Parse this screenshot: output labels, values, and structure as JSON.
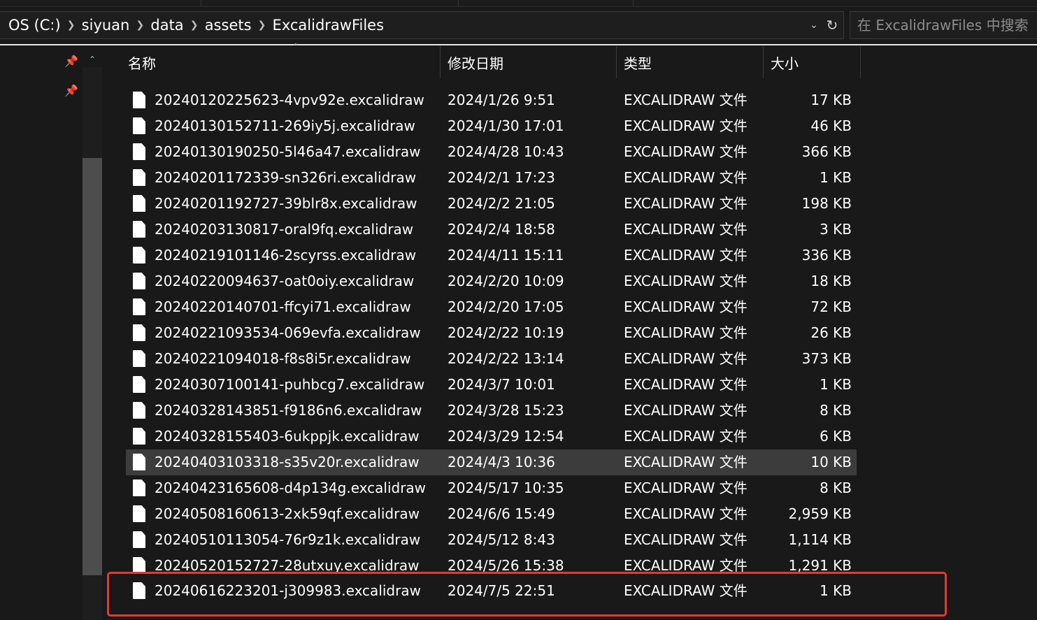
{
  "address_bar": {
    "crumbs": [
      "OS (C:)",
      "siyuan",
      "data",
      "assets",
      "ExcalidrawFiles"
    ],
    "separator_icon": "chevron-right-icon",
    "dropdown_icon": "chevron-down-icon",
    "refresh_icon": "refresh-icon"
  },
  "search": {
    "placeholder": "在 ExcalidrawFiles 中搜索"
  },
  "nav": {
    "pin_icon": "pin-icon",
    "scroll_up_icon": "chevron-up-icon"
  },
  "columns": {
    "name": "名称",
    "date": "修改日期",
    "type": "类型",
    "size": "大小"
  },
  "files": [
    {
      "name": "20240120225623-4vpv92e.excalidraw",
      "date": "2024/1/26 9:51",
      "type": "EXCALIDRAW 文件",
      "size": "17 KB"
    },
    {
      "name": "20240130152711-269iy5j.excalidraw",
      "date": "2024/1/30 17:01",
      "type": "EXCALIDRAW 文件",
      "size": "46 KB"
    },
    {
      "name": "20240130190250-5l46a47.excalidraw",
      "date": "2024/4/28 10:43",
      "type": "EXCALIDRAW 文件",
      "size": "366 KB"
    },
    {
      "name": "20240201172339-sn326ri.excalidraw",
      "date": "2024/2/1 17:23",
      "type": "EXCALIDRAW 文件",
      "size": "1 KB"
    },
    {
      "name": "20240201192727-39blr8x.excalidraw",
      "date": "2024/2/2 21:05",
      "type": "EXCALIDRAW 文件",
      "size": "198 KB"
    },
    {
      "name": "20240203130817-oral9fq.excalidraw",
      "date": "2024/2/4 18:58",
      "type": "EXCALIDRAW 文件",
      "size": "3 KB"
    },
    {
      "name": "20240219101146-2scyrss.excalidraw",
      "date": "2024/4/11 15:11",
      "type": "EXCALIDRAW 文件",
      "size": "336 KB"
    },
    {
      "name": "20240220094637-oat0oiy.excalidraw",
      "date": "2024/2/20 10:09",
      "type": "EXCALIDRAW 文件",
      "size": "18 KB"
    },
    {
      "name": "20240220140701-ffcyi71.excalidraw",
      "date": "2024/2/20 17:05",
      "type": "EXCALIDRAW 文件",
      "size": "72 KB"
    },
    {
      "name": "20240221093534-069evfa.excalidraw",
      "date": "2024/2/22 10:19",
      "type": "EXCALIDRAW 文件",
      "size": "26 KB"
    },
    {
      "name": "20240221094018-f8s8i5r.excalidraw",
      "date": "2024/2/22 13:14",
      "type": "EXCALIDRAW 文件",
      "size": "373 KB"
    },
    {
      "name": "20240307100141-puhbcg7.excalidraw",
      "date": "2024/3/7 10:01",
      "type": "EXCALIDRAW 文件",
      "size": "1 KB"
    },
    {
      "name": "20240328143851-f9186n6.excalidraw",
      "date": "2024/3/28 15:23",
      "type": "EXCALIDRAW 文件",
      "size": "8 KB"
    },
    {
      "name": "20240328155403-6ukppjk.excalidraw",
      "date": "2024/3/29 12:54",
      "type": "EXCALIDRAW 文件",
      "size": "6 KB"
    },
    {
      "name": "20240403103318-s35v20r.excalidraw",
      "date": "2024/4/3 10:36",
      "type": "EXCALIDRAW 文件",
      "size": "10 KB",
      "selected": true
    },
    {
      "name": "20240423165608-d4p134g.excalidraw",
      "date": "2024/5/17 10:35",
      "type": "EXCALIDRAW 文件",
      "size": "8 KB"
    },
    {
      "name": "20240508160613-2xk59qf.excalidraw",
      "date": "2024/6/6 15:49",
      "type": "EXCALIDRAW 文件",
      "size": "2,959 KB"
    },
    {
      "name": "20240510113054-76r9z1k.excalidraw",
      "date": "2024/5/12 8:43",
      "type": "EXCALIDRAW 文件",
      "size": "1,114 KB"
    },
    {
      "name": "20240520152727-28utxuy.excalidraw",
      "date": "2024/5/26 15:38",
      "type": "EXCALIDRAW 文件",
      "size": "1,291 KB",
      "clipped": true
    },
    {
      "name": "20240616223201-j309983.excalidraw",
      "date": "2024/7/5 22:51",
      "type": "EXCALIDRAW 文件",
      "size": "1 KB",
      "highlighted": true
    }
  ],
  "colors": {
    "background": "#191919",
    "selection": "#3c3c3c",
    "highlight_border": "#e53935",
    "text": "#ffffff"
  }
}
